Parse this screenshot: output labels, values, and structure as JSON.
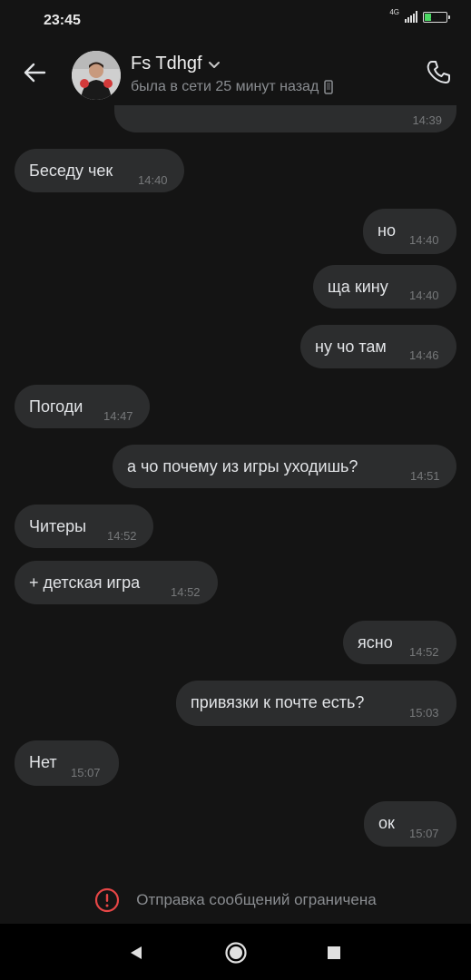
{
  "status_bar": {
    "time": "23:45",
    "network": "4G",
    "battery": "25"
  },
  "header": {
    "name": "Fs Tdhgf",
    "status": "была в сети 25 минут назад"
  },
  "messages": [
    {
      "side": "out",
      "text": "",
      "time": "14:39"
    },
    {
      "side": "in",
      "text": "Беседу чек",
      "time": "14:40"
    },
    {
      "side": "out",
      "text": "но",
      "time": "14:40"
    },
    {
      "side": "out",
      "text": "ща кину",
      "time": "14:40"
    },
    {
      "side": "out",
      "text": "ну чо там",
      "time": "14:46"
    },
    {
      "side": "in",
      "text": "Погоди",
      "time": "14:47"
    },
    {
      "side": "out",
      "text": "а чо почему из игры уходишь?",
      "time": "14:51"
    },
    {
      "side": "in",
      "text": "Читеры",
      "time": "14:52"
    },
    {
      "side": "in",
      "text": "+ детская игра",
      "time": "14:52"
    },
    {
      "side": "out",
      "text": "ясно",
      "time": "14:52"
    },
    {
      "side": "out",
      "text": "привязки к почте есть?",
      "time": "15:03"
    },
    {
      "side": "in",
      "text": "Нет",
      "time": "15:07"
    },
    {
      "side": "out",
      "text": "ок",
      "time": "15:07"
    }
  ],
  "footer": {
    "restriction_text": "Отправка сообщений ограничена"
  },
  "colors": {
    "background": "#141414",
    "bubble": "#2c2d2e",
    "warning": "#e64646"
  }
}
